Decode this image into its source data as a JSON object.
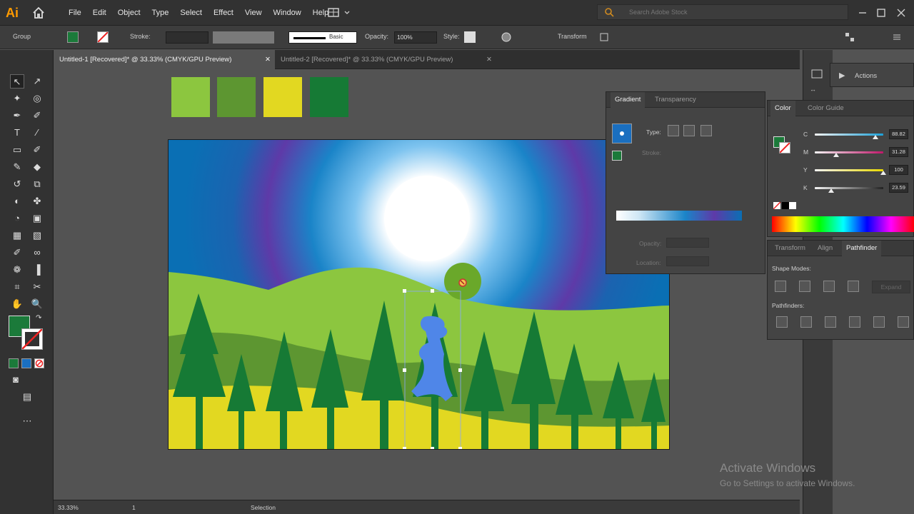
{
  "app": {
    "logo": "Ai",
    "home_icon": "home-icon",
    "workspace_icon": "workspace-switcher-icon"
  },
  "menu": [
    "File",
    "Edit",
    "Object",
    "Type",
    "Select",
    "Effect",
    "View",
    "Window",
    "Help"
  ],
  "search": {
    "placeholder": "Search Adobe Stock"
  },
  "control_bar": {
    "selection_type": "Group",
    "stroke_label": "Stroke:",
    "stroke_style": "Basic",
    "opacity_label": "Opacity:",
    "opacity_value": "100%",
    "style_label": "Style:",
    "transform_label": "Transform",
    "fill_color": "#1b7a3a"
  },
  "tabs": [
    {
      "label": "Untitled-1 [Recovered]* @ 33.33% (CMYK/GPU Preview)",
      "active": true
    },
    {
      "label": "Untitled-2 [Recovered]* @ 33.33% (CMYK/GPU Preview)",
      "active": false
    }
  ],
  "swatches": [
    "#8cc63f",
    "#5d9631",
    "#e2d821",
    "#167a35"
  ],
  "artboard": {
    "sky_color": "#0a6fb4",
    "sun_color": "#ffffff",
    "hill_light": "#8cc63f",
    "hill_dark": "#5d9631",
    "ground": "#e2d821",
    "tree": "#167a35",
    "blob": "#4f86e8"
  },
  "gradient_panel": {
    "tab_active": "Gradient",
    "tab_other": "Transparency",
    "type_label": "Type:",
    "stroke_label": "Stroke:",
    "opacity_label": "Opacity:",
    "location_label": "Location:"
  },
  "color_panel": {
    "tab_active": "Color",
    "tab_other": "Color Guide",
    "channels": [
      {
        "name": "C",
        "value": "88.82",
        "fraction": 0.888,
        "color": "#1da1d8"
      },
      {
        "name": "M",
        "value": "31.28",
        "fraction": 0.313,
        "color": "#c0176a"
      },
      {
        "name": "Y",
        "value": "100",
        "fraction": 1.0,
        "color": "#e8d800"
      },
      {
        "name": "K",
        "value": "23.59",
        "fraction": 0.236,
        "color": "#222"
      }
    ]
  },
  "actions_panel": {
    "label": "Actions"
  },
  "pathfinder_panel": {
    "tabs": [
      "Transform",
      "Align",
      "Pathfinder"
    ],
    "active": "Pathfinder",
    "shape_modes": "Shape Modes:",
    "pathfinders": "Pathfinders:",
    "expand": "Expand"
  },
  "status": {
    "zoom": "33.33%",
    "artboard": "1",
    "tool": "Selection"
  },
  "watermark": {
    "line1": "Activate Windows",
    "line2": "Go to Settings to activate Windows."
  }
}
